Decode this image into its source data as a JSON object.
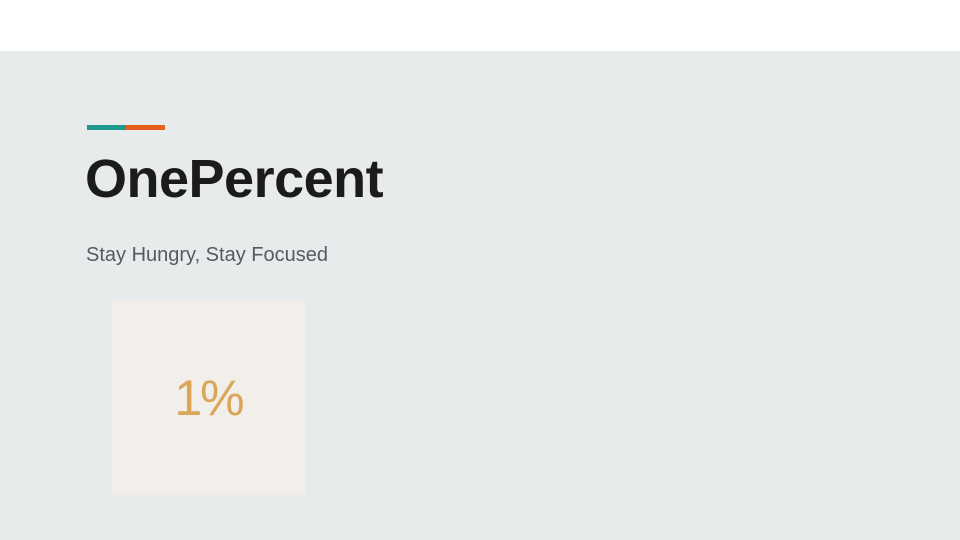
{
  "slide": {
    "title": "OnePercent",
    "subtitle": "Stay Hungry, Stay Focused",
    "logo_text": "1%"
  },
  "colors": {
    "background": "#e8ebec",
    "accent_teal": "#1f9a8e",
    "accent_orange": "#e5601c",
    "title": "#1b1b1b",
    "subtitle": "#555a5c",
    "logo_tile": "#f2efea",
    "logo_text": "#dba658"
  }
}
